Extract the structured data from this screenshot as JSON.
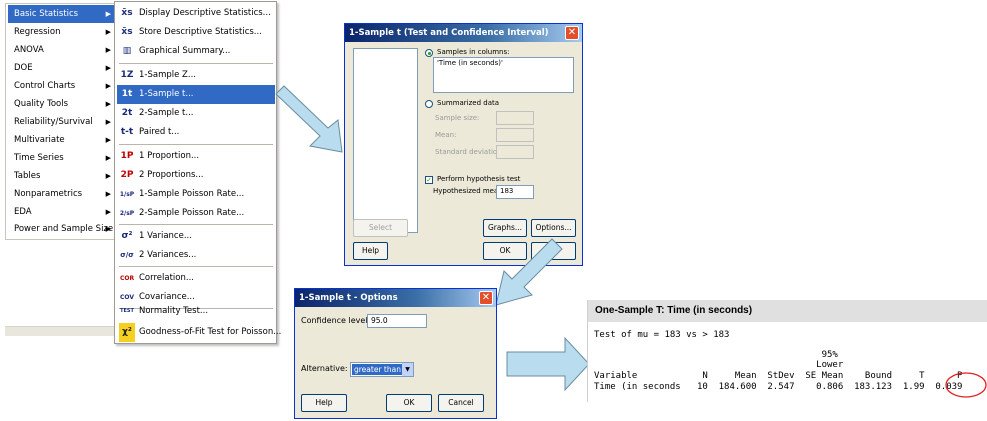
{
  "main_menu": {
    "items": [
      {
        "label": "Basic Statistics",
        "active": true
      },
      {
        "label": "Regression"
      },
      {
        "label": "ANOVA"
      },
      {
        "label": "DOE"
      },
      {
        "label": "Control Charts"
      },
      {
        "label": "Quality Tools"
      },
      {
        "label": "Reliability/Survival"
      },
      {
        "label": "Multivariate"
      },
      {
        "label": "Time Series"
      },
      {
        "label": "Tables"
      },
      {
        "label": "Nonparametrics"
      },
      {
        "label": "EDA"
      },
      {
        "label": "Power and Sample Size"
      }
    ]
  },
  "submenu": {
    "items": [
      {
        "icon": "x̄s",
        "label": "Display Descriptive Statistics..."
      },
      {
        "icon": "x̄s",
        "label": "Store Descriptive Statistics..."
      },
      {
        "icon": "▥",
        "label": "Graphical Summary..."
      },
      {
        "icon": "1Z",
        "label": "1-Sample Z..."
      },
      {
        "icon": "1t",
        "label": "1-Sample t...",
        "active": true
      },
      {
        "icon": "2t",
        "label": "2-Sample t..."
      },
      {
        "icon": "t-t",
        "label": "Paired t..."
      },
      {
        "icon": "1P",
        "label": "1 Proportion..."
      },
      {
        "icon": "2P",
        "label": "2 Proportions..."
      },
      {
        "icon": "1/sP",
        "label": "1-Sample Poisson Rate..."
      },
      {
        "icon": "2/sP",
        "label": "2-Sample Poisson Rate..."
      },
      {
        "icon": "σ²",
        "label": "1 Variance..."
      },
      {
        "icon": "σ/σ",
        "label": "2 Variances..."
      },
      {
        "icon": "COR",
        "label": "Correlation..."
      },
      {
        "icon": "COV",
        "label": "Covariance..."
      },
      {
        "icon": "TEST",
        "label": "Normality Test..."
      },
      {
        "icon": "χ²",
        "label": "Goodness-of-Fit Test for Poisson..."
      }
    ]
  },
  "dialog_ttest": {
    "title": "1-Sample t (Test and Confidence Interval)",
    "close": "✕",
    "samples_in_columns_label": "Samples in columns:",
    "samples_value": "'Time (in seconds)'",
    "summarized_label": "Summarized data",
    "sample_size_label": "Sample size:",
    "mean_label": "Mean:",
    "std_label": "Standard deviation:",
    "perform_test_label": "Perform hypothesis test",
    "hyp_mean_label": "Hypothesized mean:",
    "hyp_mean_value": "183",
    "select_btn": "Select",
    "graphs_btn": "Graphs...",
    "options_btn": "Options...",
    "help_btn": "Help",
    "ok_btn": "OK"
  },
  "dialog_options": {
    "title": "1-Sample t - Options",
    "close": "✕",
    "conf_label": "Confidence level:",
    "conf_value": "95.0",
    "alt_label": "Alternative:",
    "alt_value": "greater than",
    "help_btn": "Help",
    "ok_btn": "OK",
    "cancel_btn": "Cancel"
  },
  "output": {
    "title": "One-Sample T: Time (in seconds)",
    "test_line": "Test of mu = 183 vs > 183",
    "hdr1": "                                          95%",
    "hdr2": "                                         Lower",
    "hdr3": "Variable            N     Mean  StDev  SE Mean    Bound     T      P",
    "row": "Time (in seconds   10  184.600  2.547    0.806  183.123  1.99  0.039"
  },
  "colors": {
    "accent": "#316ac5",
    "arrow_fill": "#b9ddee",
    "circle": "#e02020"
  }
}
